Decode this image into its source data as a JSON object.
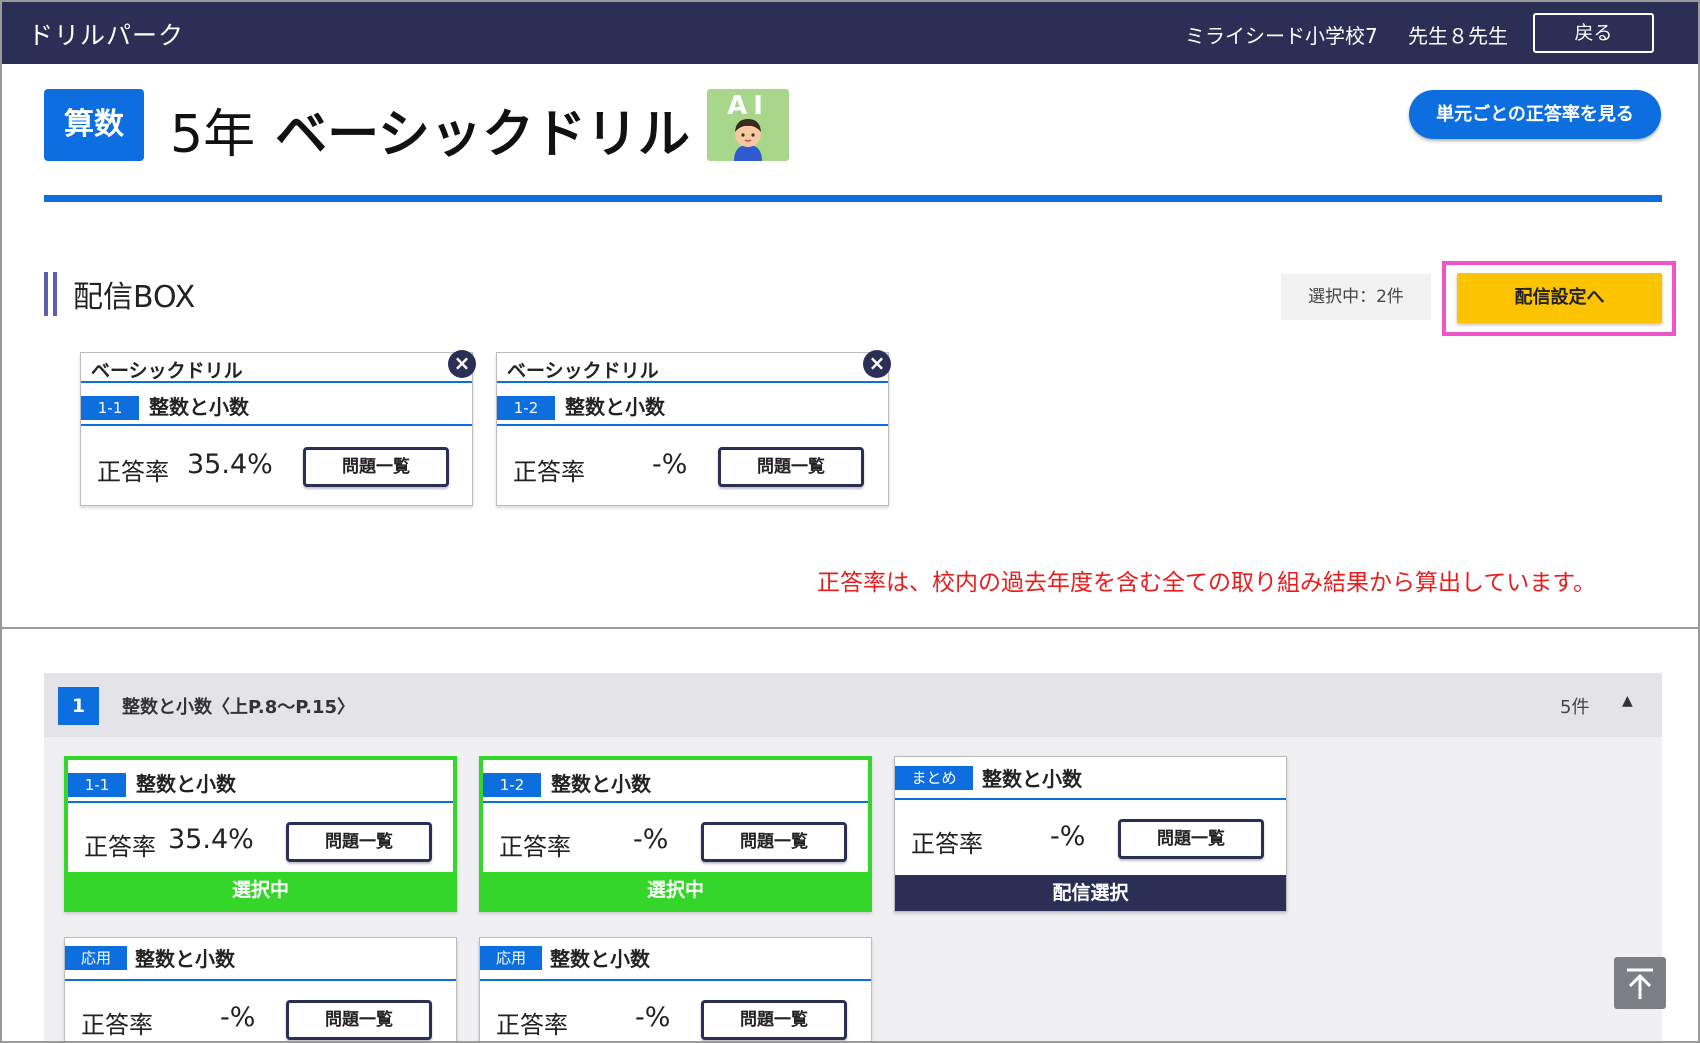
{
  "topbar": {
    "app_title": "ドリルパーク",
    "school": "ミライシード小学校7",
    "teacher": "先生８先生",
    "back_label": "戻る"
  },
  "header": {
    "subject": "算数",
    "grade": "5年",
    "title": "ベーシックドリル",
    "ai_label": "AI",
    "rate_by_unit_label": "単元ごとの正答率を見る"
  },
  "delivery_box": {
    "title": "配信BOX",
    "selected_count": "選択中：2件",
    "delivery_button": "配信設定へ",
    "cards": [
      {
        "drill": "ベーシックドリル",
        "tag": "1-1",
        "unit": "整数と小数",
        "rate_label": "正答率",
        "rate": "35.4%",
        "list_label": "問題一覧",
        "close": "×"
      },
      {
        "drill": "ベーシックドリル",
        "tag": "1-2",
        "unit": "整数と小数",
        "rate_label": "正答率",
        "rate": "-%",
        "list_label": "問題一覧",
        "close": "×"
      }
    ],
    "note": "正答率は、校内の過去年度を含む全ての取り組み結果から算出しています。"
  },
  "unit_section": {
    "number": "1",
    "title": "整数と小数〈上P.8〜P.15〉",
    "count": "5件",
    "caret": "▲",
    "cards": [
      {
        "tag": "1-1",
        "unit": "整数と小数",
        "rate_label": "正答率",
        "rate": "35.4%",
        "list_label": "問題一覧",
        "status": "選択中"
      },
      {
        "tag": "1-2",
        "unit": "整数と小数",
        "rate_label": "正答率",
        "rate": "-%",
        "list_label": "問題一覧",
        "status": "選択中"
      },
      {
        "tag": "まとめ",
        "unit": "整数と小数",
        "rate_label": "正答率",
        "rate": "-%",
        "list_label": "問題一覧",
        "status": "配信選択"
      },
      {
        "tag": "応用",
        "unit": "整数と小数",
        "rate_label": "正答率",
        "rate": "-%",
        "list_label": "問題一覧"
      },
      {
        "tag": "応用",
        "unit": "整数と小数",
        "rate_label": "正答率",
        "rate": "-%",
        "list_label": "問題一覧"
      }
    ]
  },
  "icons": {
    "scroll_top": "arrow-up-to-top-icon"
  },
  "colors": {
    "navy": "#2c2f55",
    "blue": "#0d6ee0",
    "green": "#34d62a",
    "yellow": "#fcc400",
    "pink": "#ee55c8",
    "red_note": "#e81d1d"
  }
}
